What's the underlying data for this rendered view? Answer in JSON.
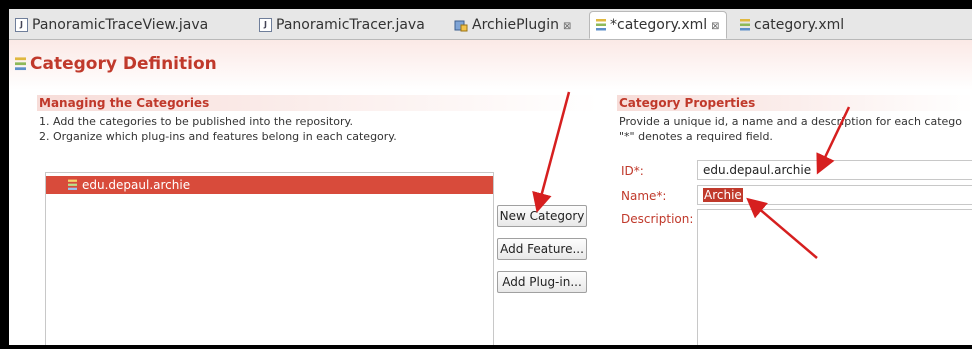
{
  "tabs": [
    {
      "label": "PanoramicTraceView.java",
      "icon": "java-file-icon"
    },
    {
      "label": "PanoramicTracer.java",
      "icon": "java-file-icon"
    },
    {
      "label": "ArchiePlugin",
      "icon": "plugin-icon"
    },
    {
      "label": "*category.xml",
      "icon": "xml-category-icon"
    },
    {
      "label": "category.xml",
      "icon": "xml-category-icon"
    }
  ],
  "close_glyph": "⊠",
  "page_title": "Category Definition",
  "managing": {
    "heading": "Managing the Categories",
    "line1": "1. Add the categories to be published into the repository.",
    "line2": "2. Organize which plug-ins and features belong in each category.",
    "items": [
      "edu.depaul.archie"
    ],
    "buttons": {
      "new_category": "New Category",
      "add_feature": "Add Feature...",
      "add_plugin": "Add Plug-in..."
    }
  },
  "properties": {
    "heading": "Category Properties",
    "line1": "Provide a unique id, a name and a description for each catego",
    "line2": "\"*\" denotes a required field.",
    "id_label": "ID*:",
    "id_value": "edu.depaul.archie",
    "name_label": "Name*:",
    "name_value": "Archie",
    "description_label": "Description:",
    "description_value": ""
  },
  "colors": {
    "accent": "#c0392b",
    "selection": "#d84b3b",
    "annotation_arrow": "#d61f1f"
  }
}
